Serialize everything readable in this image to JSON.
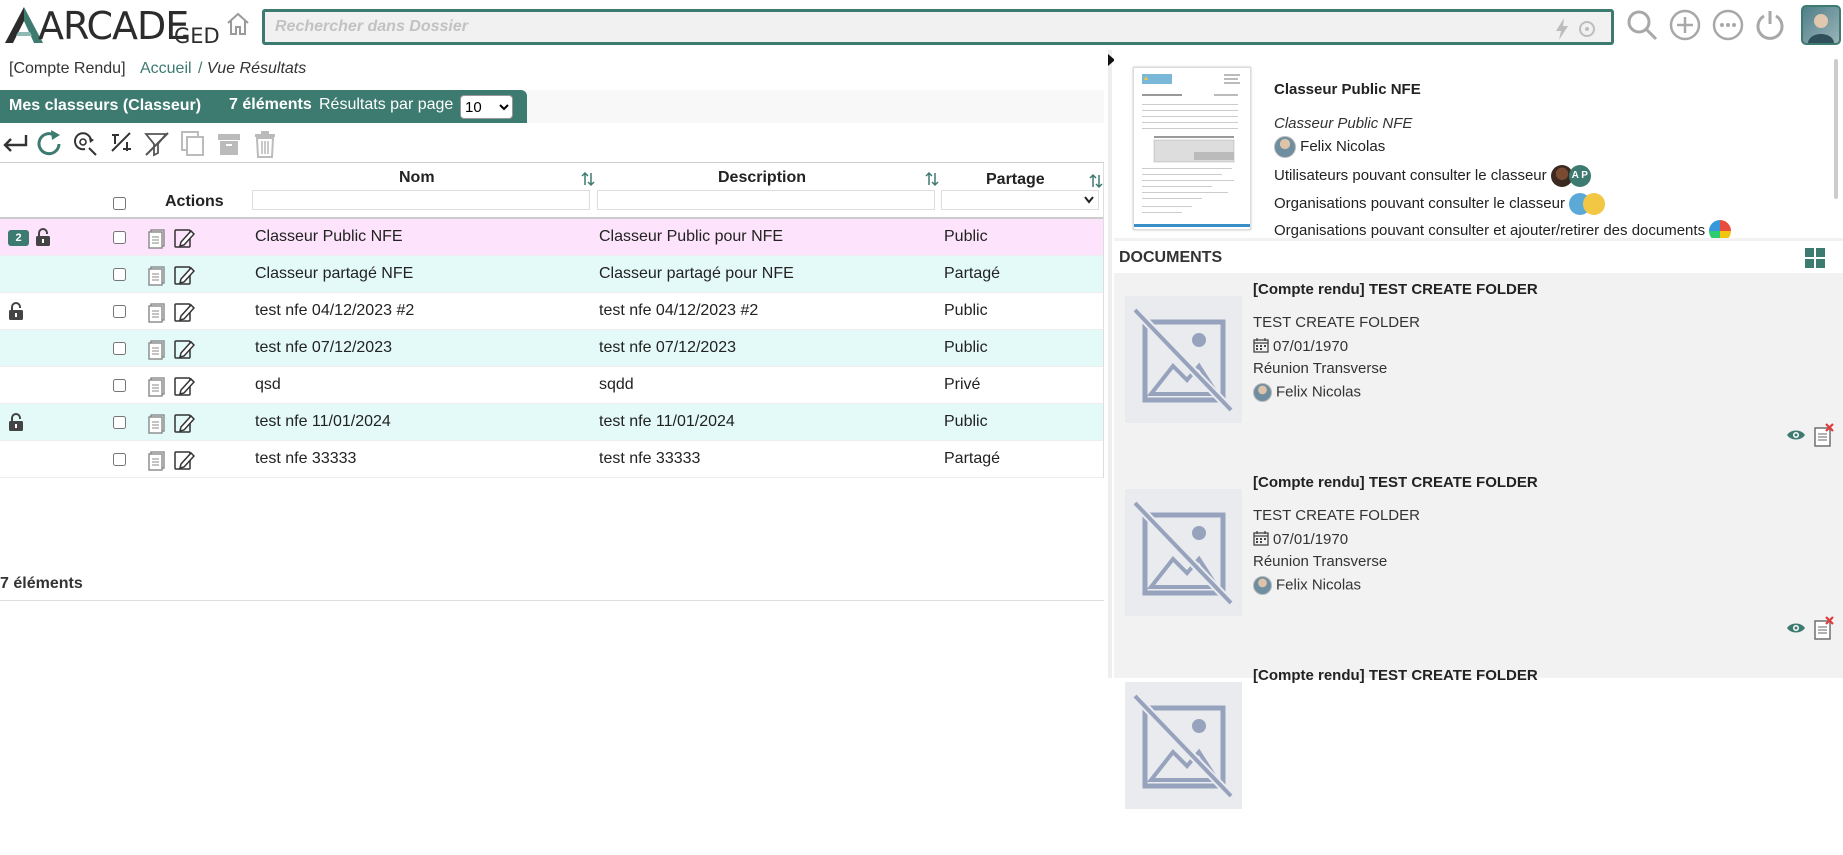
{
  "app": {
    "logo_text": "ARCADE",
    "logo_suffix": "GED",
    "search_placeholder": "Rechercher dans Dossier",
    "colors": {
      "accent": "#3d7a70",
      "row_highlight": "#fde3fb",
      "row_alt": "#e3faf8"
    },
    "icons": [
      "home-icon",
      "bolt-icon",
      "refresh-icon",
      "search-icon",
      "add-icon",
      "more-icon",
      "power-icon",
      "user-avatar"
    ]
  },
  "breadcrumb": {
    "context": "[Compte Rendu]",
    "home": "Accueil",
    "separator": "/",
    "current": "Vue Résultats"
  },
  "results": {
    "title": "Mes classeurs (Classeur)",
    "count": "7 éléments",
    "per_page_label": "Résultats par page",
    "per_page_value": "10",
    "per_page_options": [
      "10"
    ],
    "footer_count": "7 éléments"
  },
  "toolbar": [
    "back-icon",
    "refresh-icon",
    "search-refresh-icon",
    "unlink-icon",
    "filter-off-icon",
    "copy-icon",
    "archive-icon",
    "trash-icon"
  ],
  "columns": {
    "actions": "Actions",
    "name": "Nom",
    "description": "Description",
    "sharing": "Partage"
  },
  "rows": [
    {
      "badge": "2",
      "locked": true,
      "name": "Classeur Public NFE",
      "description": "Classeur Public pour NFE",
      "sharing": "Public",
      "style": "highlight"
    },
    {
      "badge": "",
      "locked": false,
      "name": "Classeur partagé NFE",
      "description": "Classeur partagé pour NFE",
      "sharing": "Partagé",
      "style": "alt"
    },
    {
      "badge": "",
      "locked": true,
      "name": "test nfe 04/12/2023 #2",
      "description": "test nfe 04/12/2023 #2",
      "sharing": "Public",
      "style": "plain"
    },
    {
      "badge": "",
      "locked": false,
      "name": "test nfe 07/12/2023",
      "description": "test nfe 07/12/2023",
      "sharing": "Public",
      "style": "alt"
    },
    {
      "badge": "",
      "locked": false,
      "name": "qsd",
      "description": "sqdd",
      "sharing": "Privé",
      "style": "plain"
    },
    {
      "badge": "",
      "locked": true,
      "name": "test nfe 11/01/2024",
      "description": "test nfe 11/01/2024",
      "sharing": "Public",
      "style": "alt"
    },
    {
      "badge": "",
      "locked": false,
      "name": "test nfe 33333",
      "description": "test nfe 33333",
      "sharing": "Partagé",
      "style": "plain"
    }
  ],
  "detail": {
    "title": "Classeur Public NFE",
    "subtitle": "Classeur Public NFE",
    "owner": "Felix Nicolas",
    "line_users": "Utilisateurs pouvant consulter le classeur",
    "line_orgs": "Organisations pouvant consulter le classeur",
    "line_orgs_edit": "Organisations pouvant consulter et ajouter/retirer des documents",
    "user_initials": "A P"
  },
  "documents": {
    "heading": "DOCUMENTS",
    "items": [
      {
        "title": "[Compte rendu] TEST CREATE FOLDER",
        "name": "TEST CREATE FOLDER",
        "date": "07/01/1970",
        "category": "Réunion Transverse",
        "author": "Felix Nicolas"
      },
      {
        "title": "[Compte rendu] TEST CREATE FOLDER",
        "name": "TEST CREATE FOLDER",
        "date": "07/01/1970",
        "category": "Réunion Transverse",
        "author": "Felix Nicolas"
      },
      {
        "title": "[Compte rendu] TEST CREATE FOLDER",
        "name": "",
        "date": "",
        "category": "",
        "author": ""
      }
    ]
  }
}
